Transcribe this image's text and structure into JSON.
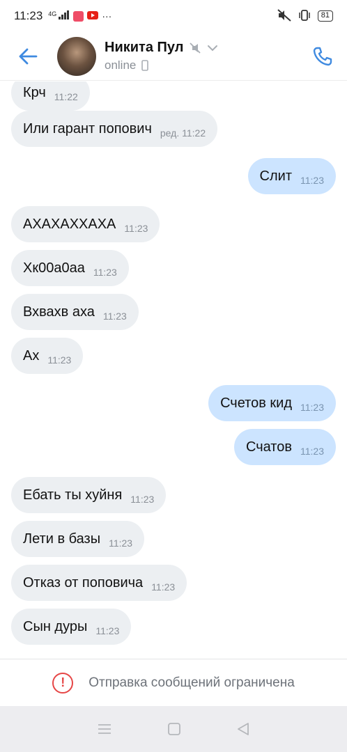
{
  "status_bar": {
    "time": "11:23",
    "network": "4G",
    "battery": "81",
    "icons": [
      "signal-icon",
      "app-icon",
      "youtube-icon",
      "more-dots-icon",
      "mute-icon",
      "vibrate-icon",
      "battery-icon"
    ]
  },
  "header": {
    "name": "Никита Пул",
    "status": "online",
    "icons": [
      "back-arrow-icon",
      "avatar",
      "muted-icon",
      "chevron-down-icon",
      "phone-device-icon",
      "phone-call-icon"
    ],
    "accent_color": "#3f8ae0"
  },
  "messages": [
    {
      "direction": "in",
      "text": "Крч",
      "time": "11:22"
    },
    {
      "direction": "in",
      "text": "Или гарант попович",
      "time": "ред. 11:22"
    },
    {
      "direction": "out",
      "text": "Слит",
      "time": "11:23"
    },
    {
      "direction": "in",
      "text": "АХАХАХХАХА",
      "time": "11:23"
    },
    {
      "direction": "in",
      "text": "Хк00а0аа",
      "time": "11:23"
    },
    {
      "direction": "in",
      "text": "Вхвахв аха",
      "time": "11:23"
    },
    {
      "direction": "in",
      "text": "Ах",
      "time": "11:23"
    },
    {
      "direction": "out",
      "text": "Счетов кид",
      "time": "11:23"
    },
    {
      "direction": "out",
      "text": "Счатов",
      "time": "11:23"
    },
    {
      "direction": "in",
      "text": "Ебать ты хуйня",
      "time": "11:23"
    },
    {
      "direction": "in",
      "text": "Лети в базы",
      "time": "11:23"
    },
    {
      "direction": "in",
      "text": "Отказ от поповича",
      "time": "11:23"
    },
    {
      "direction": "in",
      "text": "Сын дуры",
      "time": "11:23"
    }
  ],
  "footer": {
    "notice": "Отправка сообщений ограничена",
    "icon": "warning-icon",
    "color": "#e64646"
  },
  "nav_bar": {
    "buttons": [
      "menu-icon",
      "home-icon",
      "back-triangle-icon"
    ]
  }
}
